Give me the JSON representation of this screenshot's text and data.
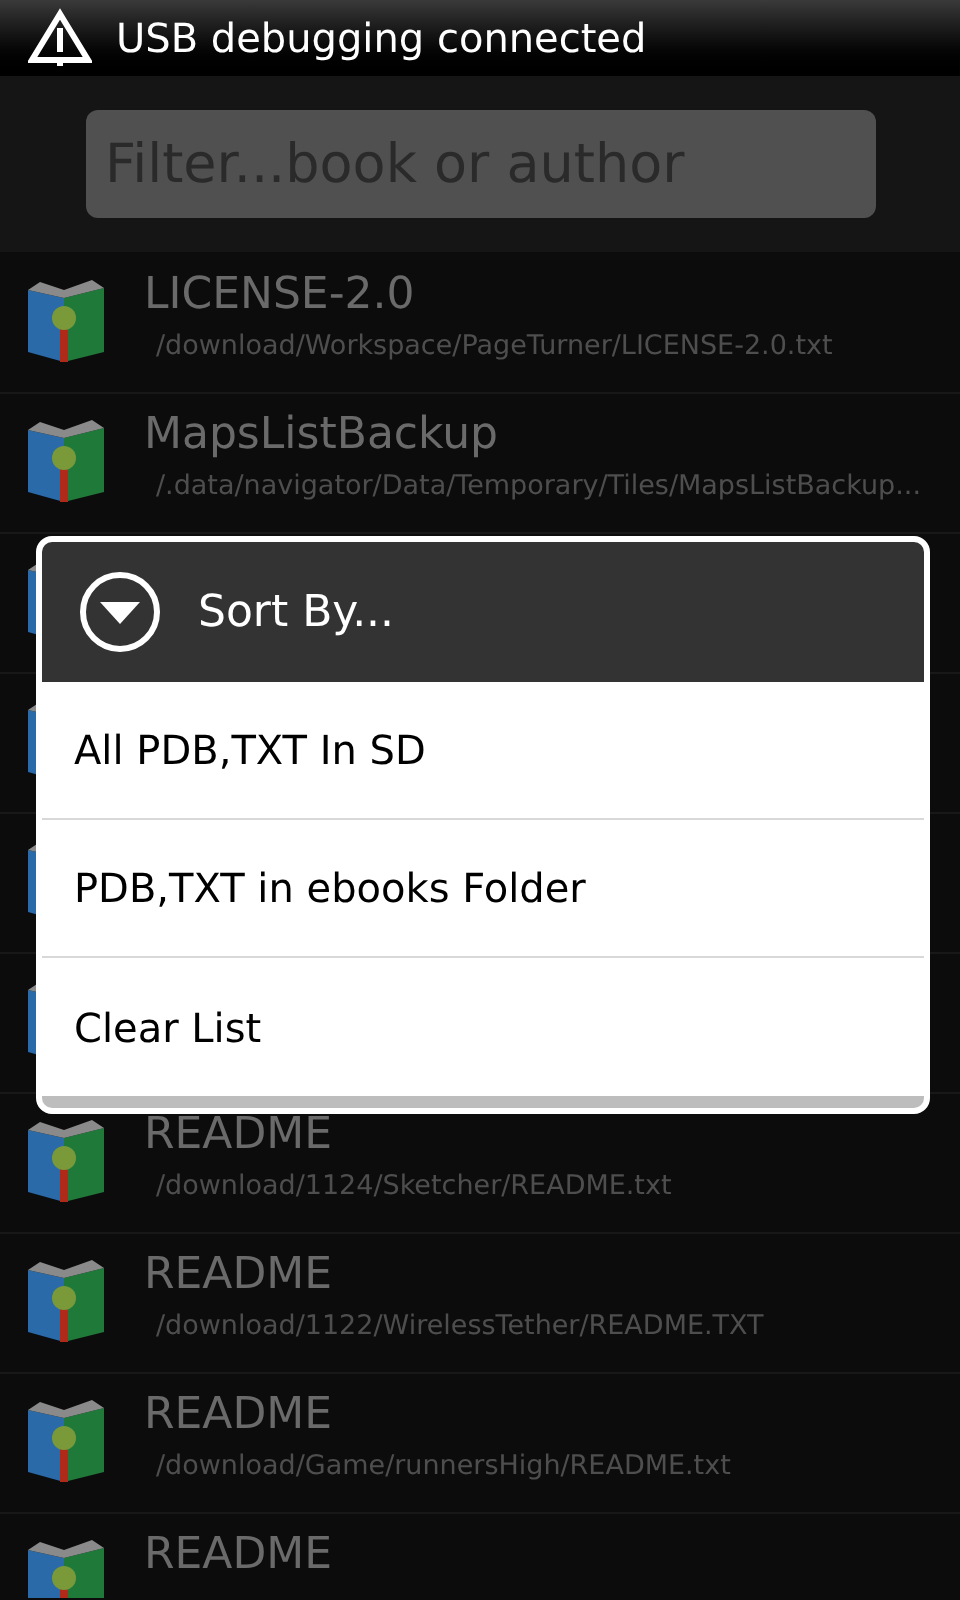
{
  "status_bar": {
    "notification": "USB debugging connected"
  },
  "filter": {
    "placeholder": "Filter...book or author"
  },
  "books": [
    {
      "kind": "book",
      "title": "LICENSE-2.0",
      "path": "/download/Workspace/PageTurner/LICENSE-2.0.txt"
    },
    {
      "kind": "book",
      "title": "MapsListBackup",
      "path": "/.data/navigator/Data/Temporary/Tiles/MapsListBackup..."
    },
    {
      "kind": "covered"
    },
    {
      "kind": "covered"
    },
    {
      "kind": "covered"
    },
    {
      "kind": "covered"
    },
    {
      "kind": "book",
      "title": "README",
      "path": "/download/1124/Sketcher/README.txt"
    },
    {
      "kind": "book",
      "title": "README",
      "path": "/download/1122/WirelessTether/README.TXT"
    },
    {
      "kind": "book",
      "title": "README",
      "path": "/download/Game/runnersHigh/README.txt"
    },
    {
      "kind": "book",
      "title": "README"
    }
  ],
  "dialog": {
    "title": "Sort By...",
    "options": [
      "All PDB,TXT In SD",
      "PDB,TXT in ebooks Folder",
      "Clear List"
    ]
  }
}
